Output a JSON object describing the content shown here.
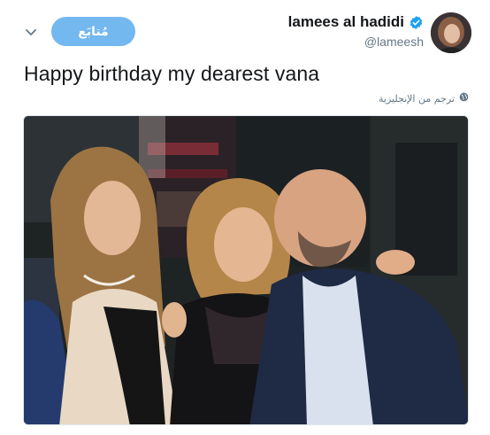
{
  "user": {
    "display_name": "lamees al hadidi",
    "handle": "@lameesh",
    "verified_icon": "verified-badge-icon",
    "avatar_icon": "avatar"
  },
  "follow_button": {
    "label": "مُتابَع"
  },
  "menu_icon": "chevron-down-icon",
  "tweet": {
    "text": "Happy birthday my dearest vana"
  },
  "translate": {
    "label": "ترجم من الإنجليزية",
    "icon": "globe-icon"
  },
  "colors": {
    "follow_button_bg": "#74b8f0",
    "verified_blue": "#1da1f2",
    "secondary_text": "#657786"
  }
}
